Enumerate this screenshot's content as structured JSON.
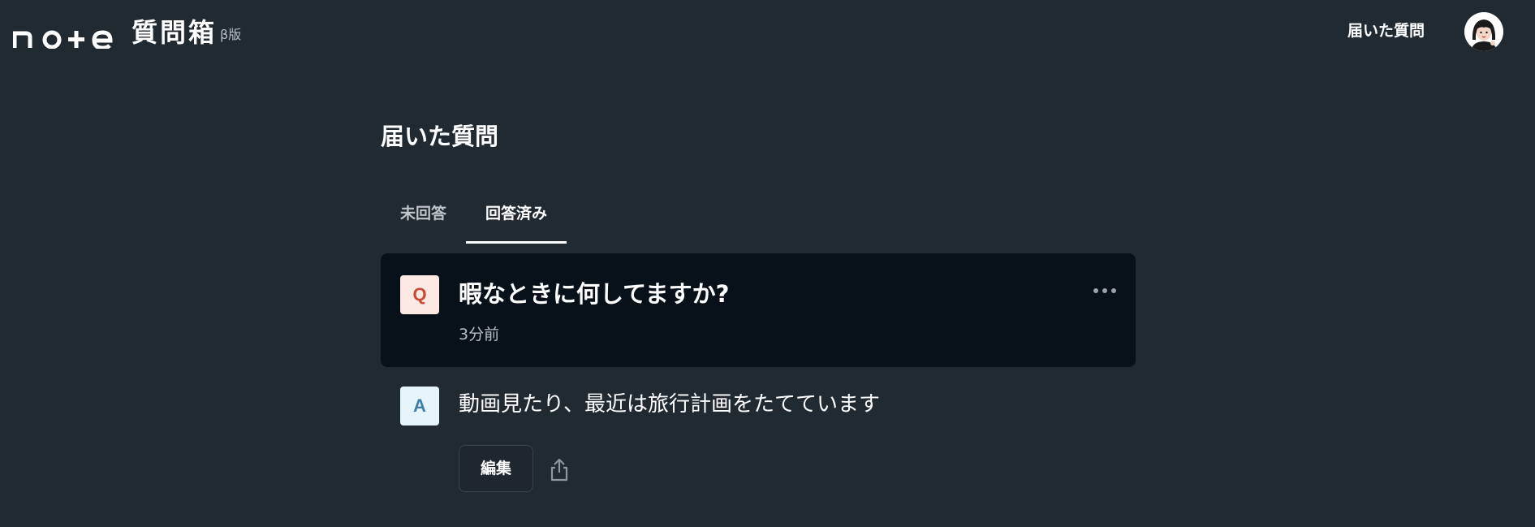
{
  "header": {
    "brand_title": "質問箱",
    "brand_beta": "β版",
    "nav_link": "届いた質問",
    "logo_icon": "note-logo",
    "avatar_icon": "user-avatar"
  },
  "main": {
    "title": "届いた質問",
    "tabs": [
      {
        "label": "未回答",
        "active": false
      },
      {
        "label": "回答済み",
        "active": true
      }
    ],
    "question": {
      "badge": "Q",
      "text": "暇なときに何してますか?",
      "time": "3分前",
      "menu_icon": "more-horizontal-icon"
    },
    "answer": {
      "badge": "A",
      "text": "動画見たり、最近は旅行計画をたてています",
      "edit_label": "編集",
      "share_icon": "share-icon"
    }
  },
  "colors": {
    "background": "#222a31",
    "card_background": "#08111a",
    "q_badge_bg": "#fce9e4",
    "q_badge_text": "#c94b35",
    "a_badge_bg": "#e6f4fb",
    "a_badge_text": "#3f7ea8"
  }
}
